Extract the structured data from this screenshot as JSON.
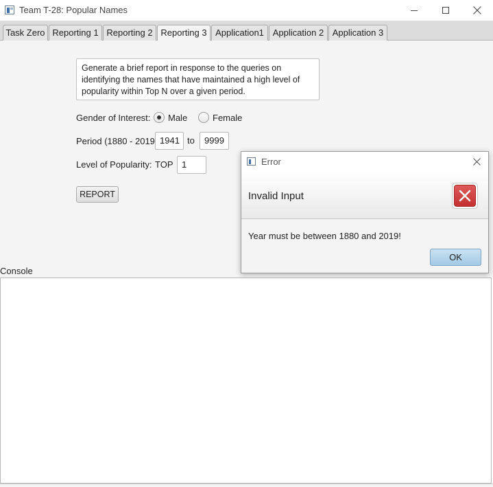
{
  "window": {
    "title": "Team T-28: Popular Names"
  },
  "tabs": [
    {
      "label": "Task Zero",
      "active": false
    },
    {
      "label": "Reporting 1",
      "active": false
    },
    {
      "label": "Reporting 2",
      "active": false
    },
    {
      "label": "Reporting 3",
      "active": true
    },
    {
      "label": "Application1",
      "active": false
    },
    {
      "label": "Application 2",
      "active": false
    },
    {
      "label": "Application 3",
      "active": false
    }
  ],
  "form": {
    "description": "Generate a brief report in response to the queries on identifying the names that have maintained a high level of popularity within Top N over a given period.",
    "gender_label": "Gender of Interest:",
    "gender_options": [
      {
        "label": "Male",
        "checked": true
      },
      {
        "label": "Female",
        "checked": false
      }
    ],
    "period_label": "Period (1880 - 2019)",
    "period_start": "1941",
    "period_to": "to",
    "period_end": "9999",
    "popularity_label": "Level of Popularity:",
    "top_label": "TOP",
    "top_value": "1",
    "report_button": "REPORT"
  },
  "console": {
    "label": "Console",
    "content": ""
  },
  "dialog": {
    "title": "Error",
    "header": "Invalid Input",
    "message": "Year must be between 1880 and 2019!",
    "ok_button": "OK",
    "icon": "error-icon",
    "accent_color": "#c94040"
  }
}
